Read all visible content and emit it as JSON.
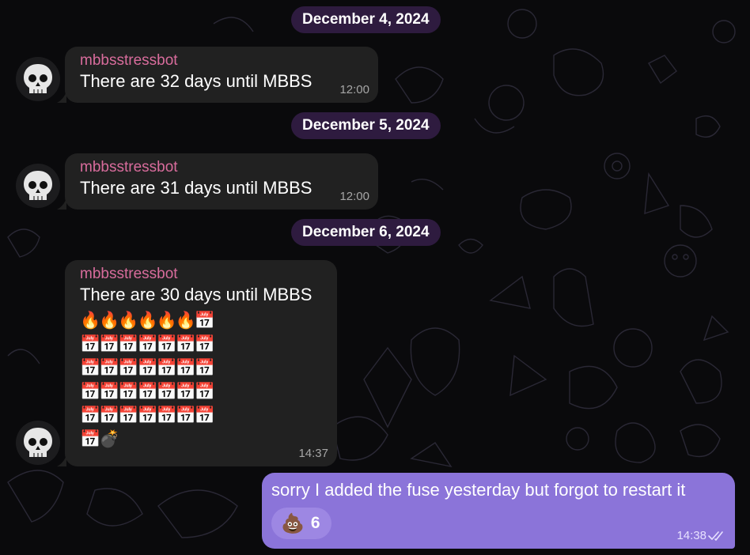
{
  "dates": [
    "December 4, 2024",
    "December 5, 2024",
    "December 6, 2024"
  ],
  "messages": [
    {
      "sender": "mbbsstressbot",
      "text": "There are 32 days until MBBS",
      "time": "12:00"
    },
    {
      "sender": "mbbsstressbot",
      "text": "There are 31 days until MBBS",
      "time": "12:00"
    },
    {
      "sender": "mbbsstressbot",
      "text": "There are 30 days until MBBS",
      "time": "14:37",
      "emoji_rows": [
        "🔥🔥🔥🔥🔥🔥📅",
        "📅📅📅📅📅📅📅",
        "📅📅📅📅📅📅📅",
        "📅📅📅📅📅📅📅",
        "📅📅📅📅📅📅📅",
        "📅💣"
      ]
    }
  ],
  "outgoing": {
    "text": "sorry I added the fuse yesterday but forgot to restart it",
    "time": "14:38",
    "reaction": {
      "emoji": "💩",
      "count": "6"
    }
  },
  "icons": {
    "avatar": "skull-icon",
    "read_receipt": "double-check-icon"
  },
  "colors": {
    "background": "#0a0a0c",
    "incoming_bubble": "#212121",
    "outgoing_bubble": "#8b74d9",
    "date_pill": "#2e1b3f",
    "sender_name": "#d86c9c"
  }
}
